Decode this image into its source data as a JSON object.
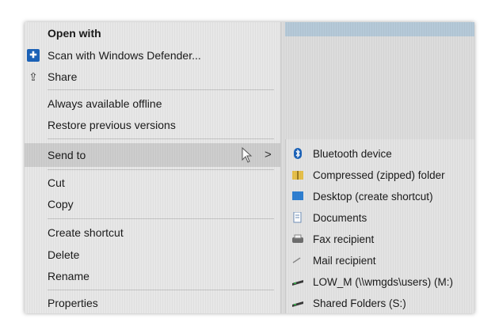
{
  "context_menu": {
    "items": [
      {
        "label": "Open with"
      },
      {
        "label": "Scan with Windows Defender..."
      },
      {
        "label": "Share"
      },
      {
        "label": "Always available offline"
      },
      {
        "label": "Restore previous versions"
      },
      {
        "label": "Send to"
      },
      {
        "label": "Cut"
      },
      {
        "label": "Copy"
      },
      {
        "label": "Create shortcut"
      },
      {
        "label": "Delete"
      },
      {
        "label": "Rename"
      },
      {
        "label": "Properties"
      }
    ],
    "submenu_arrow": ">"
  },
  "send_to_submenu": {
    "items": [
      {
        "label": "Bluetooth device",
        "icon": "bluetooth-icon"
      },
      {
        "label": "Compressed (zipped) folder",
        "icon": "zip-folder-icon"
      },
      {
        "label": "Desktop (create shortcut)",
        "icon": "desktop-icon"
      },
      {
        "label": "Documents",
        "icon": "documents-icon"
      },
      {
        "label": "Fax recipient",
        "icon": "fax-icon"
      },
      {
        "label": "Mail recipient",
        "icon": "mail-icon"
      },
      {
        "label": "LOW_M (\\\\wmgds\\users) (M:)",
        "icon": "network-drive-icon"
      },
      {
        "label": "Shared Folders (S:)",
        "icon": "network-drive-icon"
      }
    ]
  },
  "colors": {
    "menu_bg": "#e7e7e7",
    "highlight": "#cdcdcd",
    "accent_blue": "#1b62b8"
  }
}
